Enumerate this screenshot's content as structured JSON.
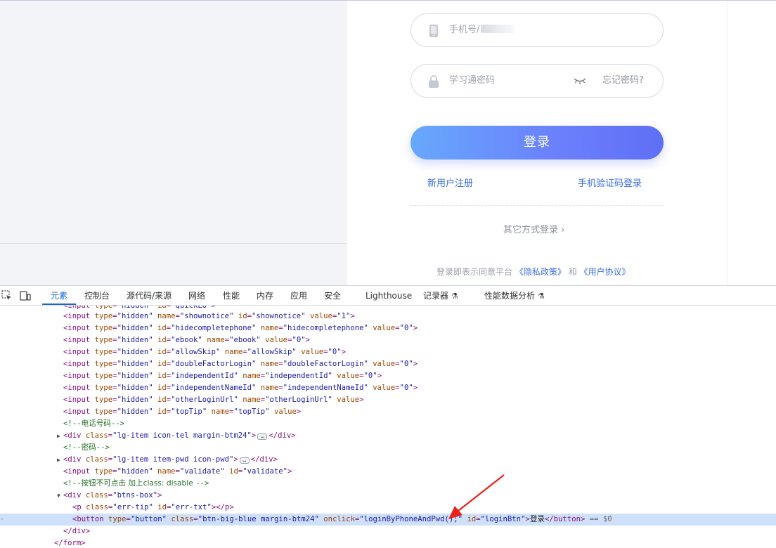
{
  "login": {
    "phone_placeholder": "手机号/",
    "password_placeholder": "学习通密码",
    "forgot_password": "忘记密码?",
    "login_button": "登录",
    "register_link": "新用户注册",
    "sms_login_link": "手机验证码登录",
    "other_login": "其它方式登录",
    "agree_prefix": "登录即表示同意平台",
    "privacy_link": "《隐私政策》",
    "agree_and": "和",
    "user_agreement_link": "《用户协议》"
  },
  "devtools": {
    "tabs": [
      {
        "label": "元素"
      },
      {
        "label": "控制台"
      },
      {
        "label": "源代码/来源"
      },
      {
        "label": "网络"
      },
      {
        "label": "性能"
      },
      {
        "label": "内存"
      },
      {
        "label": "应用"
      },
      {
        "label": "安全"
      },
      {
        "label": "Lighthouse"
      },
      {
        "label": "记录器"
      },
      {
        "label": "性能数据分析"
      }
    ],
    "code": {
      "l1": {
        "id": "shownotice",
        "name": "shownotice",
        "value": "1"
      },
      "l2": {
        "id": "hidecompletephone",
        "name": "hidecompletephone",
        "value": "0"
      },
      "l3": {
        "id": "ebook",
        "name": "ebook",
        "value": "0"
      },
      "l4": {
        "id": "allowSkip",
        "name": "allowSkip",
        "value": "0"
      },
      "l5": {
        "id": "doubleFactorLogin",
        "name": "doubleFactorLogin",
        "value": "0"
      },
      "l6": {
        "id": "independentId",
        "name": "independentId",
        "value": "0"
      },
      "l7": {
        "id": "independentNameId",
        "name": "independentNameId",
        "value": "0"
      },
      "l8": {
        "id": "otherLoginUrl",
        "name": "otherLoginUrl"
      },
      "l9": {
        "id": "topTip",
        "name": "topTip"
      },
      "comment_phone": "电话号码",
      "div_tel_class": "lg-item icon-tel margin-btm24",
      "comment_pwd": "密码",
      "div_pwd_class": "lg-item item-pwd icon-pwd",
      "validate": {
        "name": "validate",
        "id": "validate"
      },
      "comment_btn": "按钮不可点击 加上class: disable ",
      "btns_box_class": "btns-box",
      "err": {
        "class": "err-tip",
        "id": "err-txt"
      },
      "button": {
        "type": "button",
        "class": "btn-big-blue margin-btm24",
        "onclick": "loginByPhoneAndPwd();",
        "id": "loginBtn",
        "text": "登录"
      },
      "sel_suffix": "== $0"
    }
  }
}
